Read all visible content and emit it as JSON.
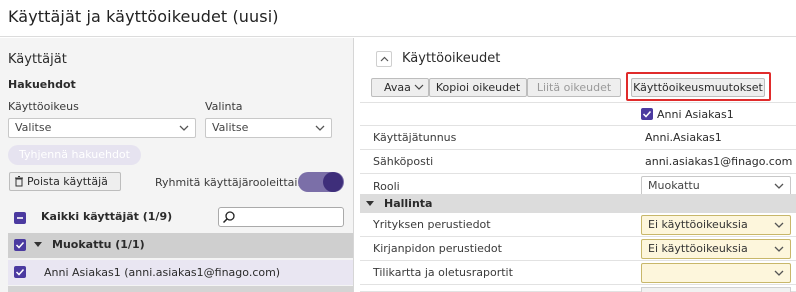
{
  "window": {
    "title": "Käyttäjät ja käyttöoikeudet (uusi)"
  },
  "left": {
    "heading": "Käyttäjät",
    "filters_heading": "Hakuehdot",
    "role_label": "Käyttöoikeus",
    "role_value": "Valitse",
    "select_label": "Valinta",
    "select_value": "Valitse",
    "clear_button": "Tyhjennä hakuehdot",
    "delete_button": "Poista käyttäjä",
    "group_toggle_label": "Ryhmitä käyttäjärooleittain",
    "all_users_label": "Kaikki käyttäjät (1/9)",
    "search_placeholder": "",
    "group_label": "Muokattu (1/1)",
    "user_label": "Anni Asiakas1 (anni.asiakas1@finago.com)"
  },
  "right": {
    "heading": "Käyttöoikeudet",
    "toolbar": {
      "open": "Avaa",
      "copy": "Kopioi oikeudet",
      "paste": "Liitä oikeudet",
      "changes": "Käyttöoikeusmuutokset"
    },
    "user_header": "Anni Asiakas1",
    "rows": [
      {
        "label": "Käyttäjätunnus",
        "value": "Anni.Asiakas1"
      },
      {
        "label": "Sähköposti",
        "value": "anni.asiakas1@finago.com"
      },
      {
        "label": "Rooli",
        "value": "Muokattu"
      }
    ],
    "section_label": "Hallinta",
    "perm_rows": [
      {
        "label": "Yrityksen perustiedot",
        "value": "Ei käyttöoikeuksia"
      },
      {
        "label": "Kirjanpidon perustiedot",
        "value": "Ei käyttöoikeuksia"
      },
      {
        "label": "Tilikartta ja oletusraportit",
        "value": ""
      }
    ]
  },
  "colors": {
    "accent": "#4b3aa0",
    "highlight_border": "#e02b2b",
    "row_selected": "#e9e6f2"
  }
}
